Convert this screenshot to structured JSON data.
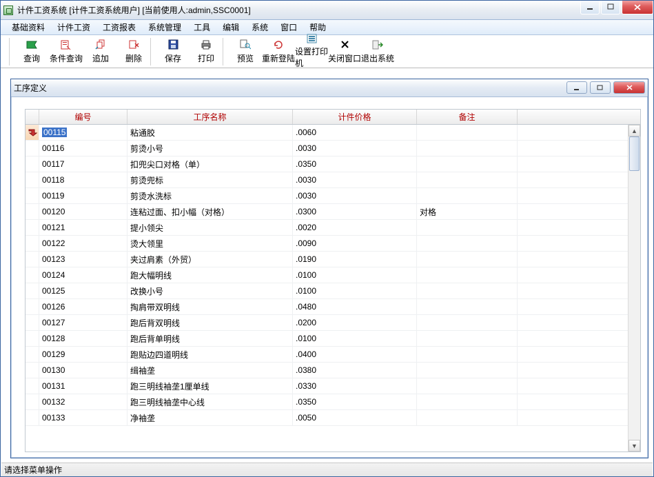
{
  "window": {
    "title": "计件工资系统  [计件工资系统用户]  [当前使用人:admin,SSC0001]"
  },
  "menu": [
    "基础资料",
    "计件工资",
    "工资报表",
    "系统管理",
    "工具",
    "编辑",
    "系统",
    "窗口",
    "帮助"
  ],
  "toolbar": [
    {
      "label": "查询",
      "icon": "query"
    },
    {
      "label": "条件查询",
      "icon": "cond"
    },
    {
      "label": "追加",
      "icon": "add"
    },
    {
      "label": "删除",
      "icon": "del"
    },
    {
      "label": "保存",
      "icon": "save"
    },
    {
      "label": "打印",
      "icon": "print"
    },
    {
      "label": "预览",
      "icon": "preview"
    },
    {
      "label": "重新登陆",
      "icon": "relog"
    },
    {
      "label": "设置打印机",
      "icon": "prset"
    },
    {
      "label": "关闭窗口",
      "icon": "close"
    },
    {
      "label": "退出系统",
      "icon": "exit"
    }
  ],
  "child": {
    "title": "工序定义",
    "columns": [
      "编号",
      "工序名称",
      "计件价格",
      "备注"
    ],
    "rows": [
      {
        "id": "00115",
        "name": "粘通胶",
        "price": ".0060",
        "note": "",
        "sel": true
      },
      {
        "id": "00116",
        "name": "剪烫小号",
        "price": ".0030",
        "note": ""
      },
      {
        "id": "00117",
        "name": "扣兜尖口对格（单）",
        "price": ".0350",
        "note": ""
      },
      {
        "id": "00118",
        "name": "剪烫兜标",
        "price": ".0030",
        "note": ""
      },
      {
        "id": "00119",
        "name": "剪烫水洗标",
        "price": ".0030",
        "note": ""
      },
      {
        "id": "00120",
        "name": "连粘过面、扣小幅（对格）",
        "price": ".0300",
        "note": "对格"
      },
      {
        "id": "00121",
        "name": "提小领尖",
        "price": ".0020",
        "note": ""
      },
      {
        "id": "00122",
        "name": "烫大领里",
        "price": ".0090",
        "note": ""
      },
      {
        "id": "00123",
        "name": "夹过肩素（外贸）",
        "price": ".0190",
        "note": ""
      },
      {
        "id": "00124",
        "name": "跑大幅明线",
        "price": ".0100",
        "note": ""
      },
      {
        "id": "00125",
        "name": "改换小号",
        "price": ".0100",
        "note": ""
      },
      {
        "id": "00126",
        "name": "掏肩带双明线",
        "price": ".0480",
        "note": ""
      },
      {
        "id": "00127",
        "name": "跑后背双明线",
        "price": ".0200",
        "note": ""
      },
      {
        "id": "00128",
        "name": "跑后背单明线",
        "price": ".0100",
        "note": ""
      },
      {
        "id": "00129",
        "name": "跑贴边四道明线",
        "price": ".0400",
        "note": ""
      },
      {
        "id": "00130",
        "name": "缉袖垄",
        "price": ".0380",
        "note": ""
      },
      {
        "id": "00131",
        "name": "跑三明线袖垄1厘单线",
        "price": ".0330",
        "note": ""
      },
      {
        "id": "00132",
        "name": "跑三明线袖垄中心线",
        "price": ".0350",
        "note": ""
      },
      {
        "id": "00133",
        "name": "净袖垄",
        "price": ".0050",
        "note": ""
      }
    ]
  },
  "status": "请选择菜单操作"
}
